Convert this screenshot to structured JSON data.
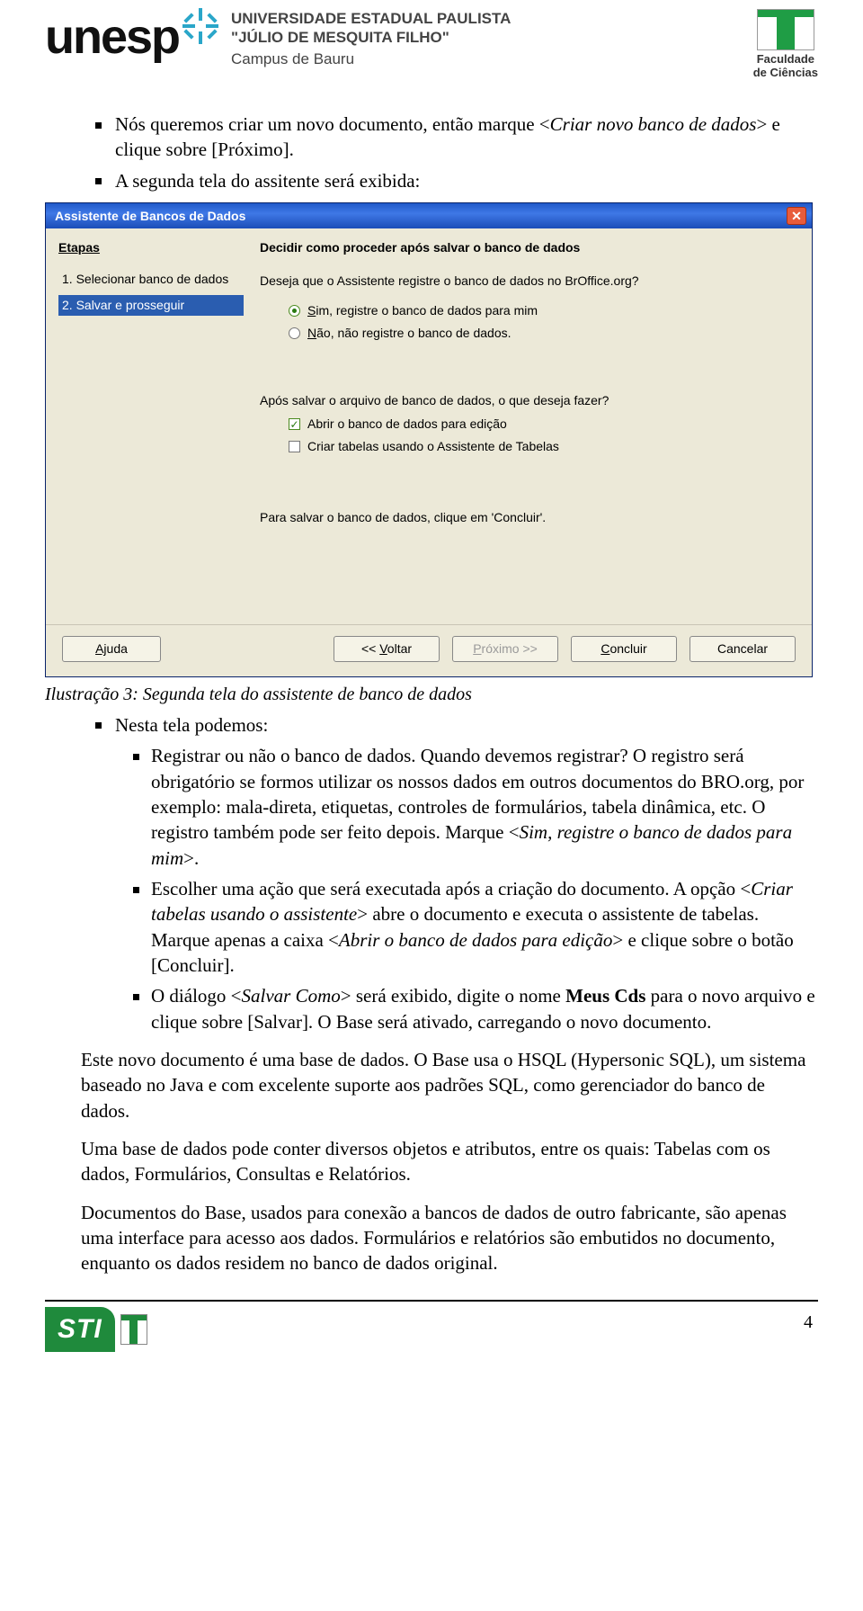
{
  "header": {
    "unesp": "unesp",
    "univ_l1": "UNIVERSIDADE ESTADUAL PAULISTA",
    "univ_l2": "\"JÚLIO DE MESQUITA FILHO\"",
    "univ_l3": "Campus de Bauru",
    "fac_l1": "Faculdade",
    "fac_l2": "de Ciências"
  },
  "body": {
    "b1_a": "Nós queremos criar um novo documento, então marque <",
    "b1_it1": "Criar novo banco de dados",
    "b1_b": "> e clique sobre [Próximo].",
    "b2": "A segunda tela do assitente será exibida:",
    "caption": "Ilustração 3: Segunda tela do assistente de banco de dados",
    "b3": "Nesta tela podemos:",
    "s1_a": "Registrar ou não o banco de dados. Quando devemos registrar? O registro será obrigatório se formos utilizar os nossos dados em outros documentos do BRO.org, por exemplo: mala-direta, etiquetas, controles de formulários, tabela dinâmica, etc. O registro também pode ser feito depois. Marque <",
    "s1_it": "Sim, registre o banco de dados para mim",
    "s1_b": ">.",
    "s2_a": "Escolher uma ação que será executada após a criação do documento. A opção <",
    "s2_it1": "Criar tabelas usando o assistente",
    "s2_b": "> abre o documento e executa o assistente de tabelas. Marque apenas a caixa <",
    "s2_it2": "Abrir o banco de dados para edição",
    "s2_c": ">  e clique sobre o botão [Concluir].",
    "s3_a": "O diálogo <",
    "s3_it": "Salvar Como",
    "s3_b": "> será exibido, digite o nome ",
    "s3_bold": "Meus Cds",
    "s3_c": " para o novo arquivo e clique sobre [Salvar]. O Base será ativado, carregando o novo documento.",
    "p1": "Este novo documento é uma base de dados. O Base usa o HSQL (Hypersonic SQL), um sistema baseado no Java e com excelente suporte aos padrões SQL, como gerenciador do banco de dados.",
    "p2": "Uma base de dados pode conter diversos objetos e atributos, entre os quais: Tabelas com os dados, Formulários, Consultas e Relatórios.",
    "p3": "Documentos do Base, usados para conexão a bancos de dados de outro fabricante, são apenas uma interface para acesso aos dados. Formulários e relatórios são embutidos no documento, enquanto os dados residem no banco de dados original."
  },
  "wizard": {
    "title": "Assistente de Bancos de Dados",
    "steps_h": "Etapas",
    "step1": "1.  Selecionar banco de dados",
    "step2": "2.  Salvar e prosseguir",
    "main_h": "Decidir como proceder após salvar o banco de dados",
    "q1": "Deseja que o Assistente registre o banco de dados no BrOffice.org?",
    "r1_pre": "S",
    "r1_rest": "im, registre o banco de dados para mim",
    "r2_pre": "N",
    "r2_rest": "ão, não registre o banco de dados.",
    "q2": "Após salvar o arquivo de banco de dados, o que deseja fazer?",
    "c1": "Abrir o banco de dados para edição",
    "c2": "Criar tabelas usando o Assistente de Tabelas",
    "save_hint": "Para salvar o banco de dados, clique em 'Concluir'.",
    "btn_help_pre": "Aj",
    "btn_help_rest": "uda",
    "btn_back_pre": "<< ",
    "btn_back_u": "V",
    "btn_back_rest": "oltar",
    "btn_next_u": "P",
    "btn_next_rest": "róximo >>",
    "btn_finish_pre": "",
    "btn_finish_u": "C",
    "btn_finish_rest": "oncluir",
    "btn_cancel": "Cancelar"
  },
  "footer": {
    "sti": "STI",
    "page": "4"
  }
}
